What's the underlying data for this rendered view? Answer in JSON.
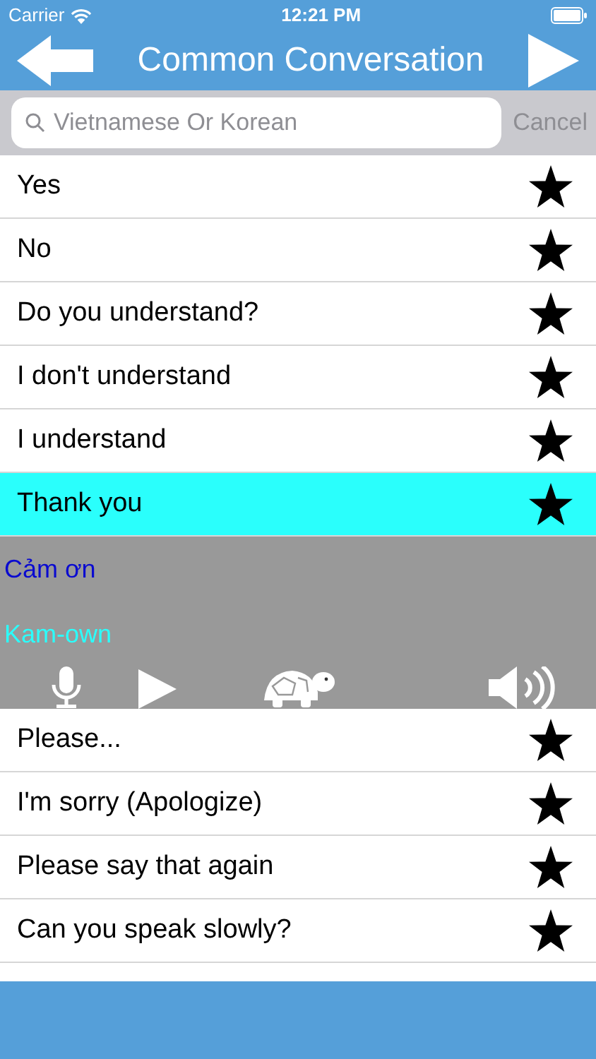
{
  "status_bar": {
    "carrier": "Carrier",
    "time": "12:21 PM"
  },
  "header": {
    "title": "Common Conversation"
  },
  "search": {
    "placeholder": "Vietnamese Or Korean",
    "cancel": "Cancel"
  },
  "phrases": [
    {
      "label": "Yes",
      "selected": false
    },
    {
      "label": "No",
      "selected": false
    },
    {
      "label": "Do you understand?",
      "selected": false
    },
    {
      "label": "I don't understand",
      "selected": false
    },
    {
      "label": "I understand",
      "selected": false
    },
    {
      "label": "Thank you",
      "selected": true,
      "translation": "Cảm ơn",
      "pronunciation": "Kam-own"
    },
    {
      "label": "Please...",
      "selected": false
    },
    {
      "label": "I'm sorry (Apologize)",
      "selected": false
    },
    {
      "label": "Please say that again",
      "selected": false
    },
    {
      "label": "Can you speak slowly?",
      "selected": false
    }
  ]
}
